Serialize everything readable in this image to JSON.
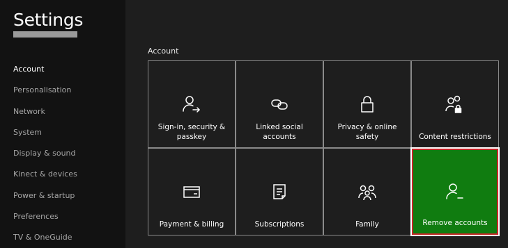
{
  "header": {
    "title": "Settings"
  },
  "sidebar": {
    "items": [
      {
        "label": "Account",
        "selected": true
      },
      {
        "label": "Personalisation"
      },
      {
        "label": "Network"
      },
      {
        "label": "System"
      },
      {
        "label": "Display & sound"
      },
      {
        "label": "Kinect & devices"
      },
      {
        "label": "Power & startup"
      },
      {
        "label": "Preferences"
      },
      {
        "label": "TV & OneGuide"
      }
    ]
  },
  "main": {
    "section_label": "Account",
    "tiles": [
      {
        "label": "Sign-in, security & passkey",
        "icon": "person-arrow-icon"
      },
      {
        "label": "Linked social accounts",
        "icon": "link-icon"
      },
      {
        "label": "Privacy & online safety",
        "icon": "lock-icon"
      },
      {
        "label": "Content restrictions",
        "icon": "people-lock-icon"
      },
      {
        "label": "Payment & billing",
        "icon": "card-icon"
      },
      {
        "label": "Subscriptions",
        "icon": "document-icon"
      },
      {
        "label": "Family",
        "icon": "family-icon"
      },
      {
        "label": "Remove accounts",
        "icon": "person-remove-icon",
        "selected": true
      }
    ]
  },
  "colors": {
    "accent_green": "#107c10",
    "focus_border": "#c42727",
    "sidebar_bg": "#121212",
    "main_bg": "#1e1e1e"
  }
}
